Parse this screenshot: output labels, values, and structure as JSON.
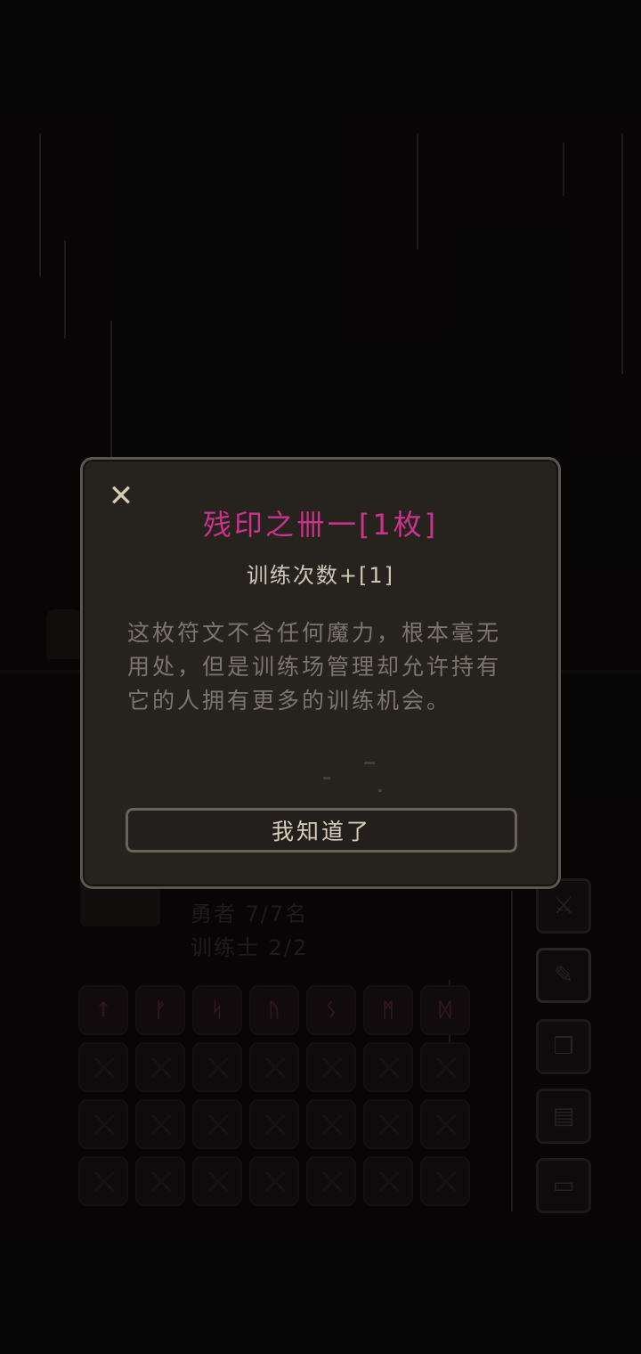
{
  "dialog": {
    "title": "残印之卌一[1枚]",
    "subtitle": "训练次数+[1]",
    "description": "这枚符文不含任何魔力，根本毫无用处，但是训练场管理却允许持有它的人拥有更多的训练机会。",
    "confirm_label": "我知道了",
    "close_icon": "✕"
  },
  "stats": {
    "heroes": "勇者 7/7名",
    "trainers": "训练士 2/2"
  },
  "runes": [
    "↑",
    "ᚠ",
    "ᛋ",
    "ᚢ",
    "ᛊ",
    "ᛗ",
    "ᛞ"
  ],
  "side_buttons": [
    {
      "icon": "swords-icon",
      "glyph": "⚔"
    },
    {
      "icon": "scroll-icon",
      "glyph": "✎"
    },
    {
      "icon": "map-icon",
      "glyph": "❐"
    },
    {
      "icon": "document-icon",
      "glyph": "▤"
    },
    {
      "icon": "monitor-icon",
      "glyph": "▭"
    }
  ],
  "colors": {
    "title": "#c9338a",
    "dialog_bg": "#26231f",
    "dialog_border": "#5c5650"
  }
}
